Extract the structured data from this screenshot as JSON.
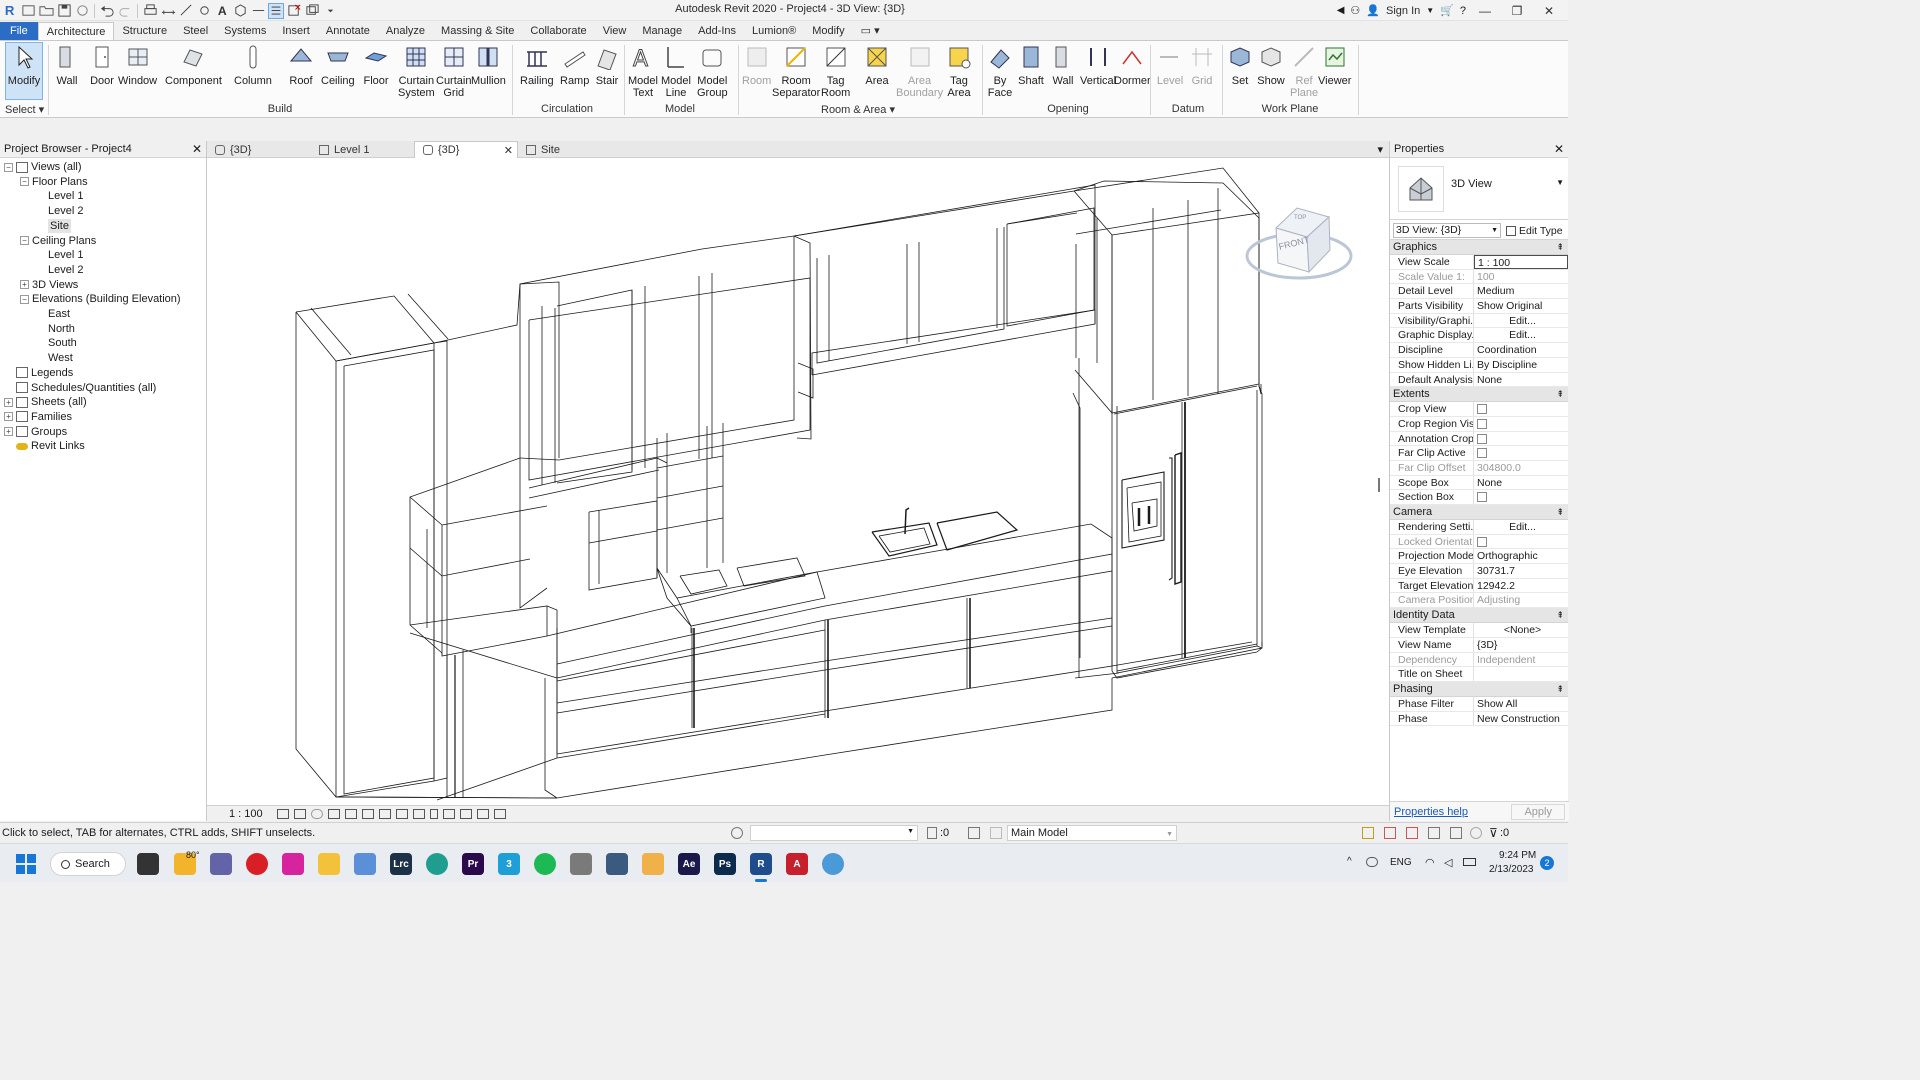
{
  "window": {
    "title": "Autodesk Revit 2020 - Project4 - 3D View: {3D}",
    "sign_in": "Sign In"
  },
  "ribbon_tabs": [
    "File",
    "Architecture",
    "Structure",
    "Steel",
    "Systems",
    "Insert",
    "Annotate",
    "Analyze",
    "Massing & Site",
    "Collaborate",
    "View",
    "Manage",
    "Add-Ins",
    "Lumion®",
    "Modify"
  ],
  "ribbon": {
    "modify": "Modify",
    "select": "Select ▾",
    "build": {
      "label": "Build",
      "buttons": [
        "Wall",
        "Door",
        "Window",
        "Component",
        "Column",
        "Roof",
        "Ceiling",
        "Floor",
        "Curtain\nSystem",
        "Curtain\nGrid",
        "Mullion"
      ]
    },
    "circulation": {
      "label": "Circulation",
      "buttons": [
        "Railing",
        "Ramp",
        "Stair"
      ]
    },
    "model": {
      "label": "Model",
      "buttons": [
        "Model\nText",
        "Model\nLine",
        "Model\nGroup"
      ]
    },
    "room_area": {
      "label": "Room & Area ▾",
      "buttons": [
        "Room",
        "Room\nSeparator",
        "Tag\nRoom",
        "Area",
        "Area\nBoundary",
        "Tag\nArea"
      ]
    },
    "opening": {
      "label": "Opening",
      "buttons": [
        "By\nFace",
        "Shaft",
        "Wall",
        "Vertical",
        "Dormer"
      ]
    },
    "datum": {
      "label": "Datum",
      "buttons": [
        "Level",
        "Grid"
      ]
    },
    "work_plane": {
      "label": "Work Plane",
      "buttons": [
        "Set",
        "Show",
        "Ref\nPlane",
        "Viewer"
      ]
    }
  },
  "project_browser": {
    "title": "Project Browser - Project4",
    "tree": [
      {
        "label": "Views (all)",
        "toggle": "−",
        "icon": "views"
      },
      {
        "label": "Floor Plans",
        "toggle": "−"
      },
      {
        "label": "Level 1"
      },
      {
        "label": "Level 2"
      },
      {
        "label": "Site",
        "selected": true
      },
      {
        "label": "Ceiling Plans",
        "toggle": "−"
      },
      {
        "label": "Level 1"
      },
      {
        "label": "Level 2"
      },
      {
        "label": "3D Views",
        "toggle": "+"
      },
      {
        "label": "Elevations (Building Elevation)",
        "toggle": "−"
      },
      {
        "label": "East"
      },
      {
        "label": "North"
      },
      {
        "label": "South"
      },
      {
        "label": "West"
      },
      {
        "label": "Legends",
        "icon": "legend"
      },
      {
        "label": "Schedules/Quantities (all)",
        "icon": "schedule"
      },
      {
        "label": "Sheets (all)",
        "toggle": "+",
        "icon": "sheet"
      },
      {
        "label": "Families",
        "toggle": "+",
        "icon": "family"
      },
      {
        "label": "Groups",
        "toggle": "+",
        "icon": "group"
      },
      {
        "label": "Revit Links",
        "icon": "link"
      }
    ]
  },
  "view_tabs": [
    {
      "label": "{3D}"
    },
    {
      "label": "Level 1"
    },
    {
      "label": "{3D}",
      "active": true
    },
    {
      "label": "Site"
    }
  ],
  "viewcube": {
    "front": "FRONT",
    "top": "TOP"
  },
  "view_control": {
    "scale": "1 : 100"
  },
  "properties": {
    "title": "Properties",
    "type_name": "3D View",
    "instance_selector": "3D View: {3D}",
    "edit_type": "Edit Type",
    "sections": [
      {
        "name": "Graphics",
        "rows": [
          {
            "n": "View Scale",
            "v": "1 : 100",
            "style": "hl"
          },
          {
            "n": "Scale Value    1:",
            "v": "100",
            "dim": true
          },
          {
            "n": "Detail Level",
            "v": "Medium"
          },
          {
            "n": "Parts Visibility",
            "v": "Show Original"
          },
          {
            "n": "Visibility/Graphi...",
            "v": "Edit...",
            "style": "btn"
          },
          {
            "n": "Graphic Display...",
            "v": "Edit...",
            "style": "btn"
          },
          {
            "n": "Discipline",
            "v": "Coordination"
          },
          {
            "n": "Show Hidden Li...",
            "v": "By Discipline"
          },
          {
            "n": "Default Analysis...",
            "v": "None"
          }
        ]
      },
      {
        "name": "Extents",
        "rows": [
          {
            "n": "Crop View",
            "check": true
          },
          {
            "n": "Crop Region Vis...",
            "check": true
          },
          {
            "n": "Annotation Crop",
            "check": true
          },
          {
            "n": "Far Clip Active",
            "check": true
          },
          {
            "n": "Far Clip Offset",
            "v": "304800.0",
            "dim": true
          },
          {
            "n": "Scope Box",
            "v": "None"
          },
          {
            "n": "Section Box",
            "check": true
          }
        ]
      },
      {
        "name": "Camera",
        "rows": [
          {
            "n": "Rendering Setti...",
            "v": "Edit...",
            "style": "btn"
          },
          {
            "n": "Locked Orientat...",
            "check": true,
            "dim": true
          },
          {
            "n": "Projection Mode",
            "v": "Orthographic"
          },
          {
            "n": "Eye Elevation",
            "v": "30731.7"
          },
          {
            "n": "Target Elevation",
            "v": "12942.2"
          },
          {
            "n": "Camera Position",
            "v": "Adjusting",
            "dim": true
          }
        ]
      },
      {
        "name": "Identity Data",
        "rows": [
          {
            "n": "View Template",
            "v": "<None>",
            "style": "btn"
          },
          {
            "n": "View Name",
            "v": "{3D}"
          },
          {
            "n": "Dependency",
            "v": "Independent",
            "dim": true
          },
          {
            "n": "Title on Sheet",
            "v": ""
          }
        ]
      },
      {
        "name": "Phasing",
        "rows": [
          {
            "n": "Phase Filter",
            "v": "Show All"
          },
          {
            "n": "Phase",
            "v": "New Construction"
          }
        ]
      }
    ],
    "help": "Properties help",
    "apply": "Apply"
  },
  "status": {
    "hint": "Click to select, TAB for alternates, CTRL adds, SHIFT unselects.",
    "worksets": ":0",
    "model": "Main Model",
    "filter": ":0"
  },
  "taskbar": {
    "search": "Search",
    "temp": "80°",
    "lang": "ENG",
    "time": "9:24 PM",
    "date": "2/13/2023",
    "notif": "2"
  }
}
